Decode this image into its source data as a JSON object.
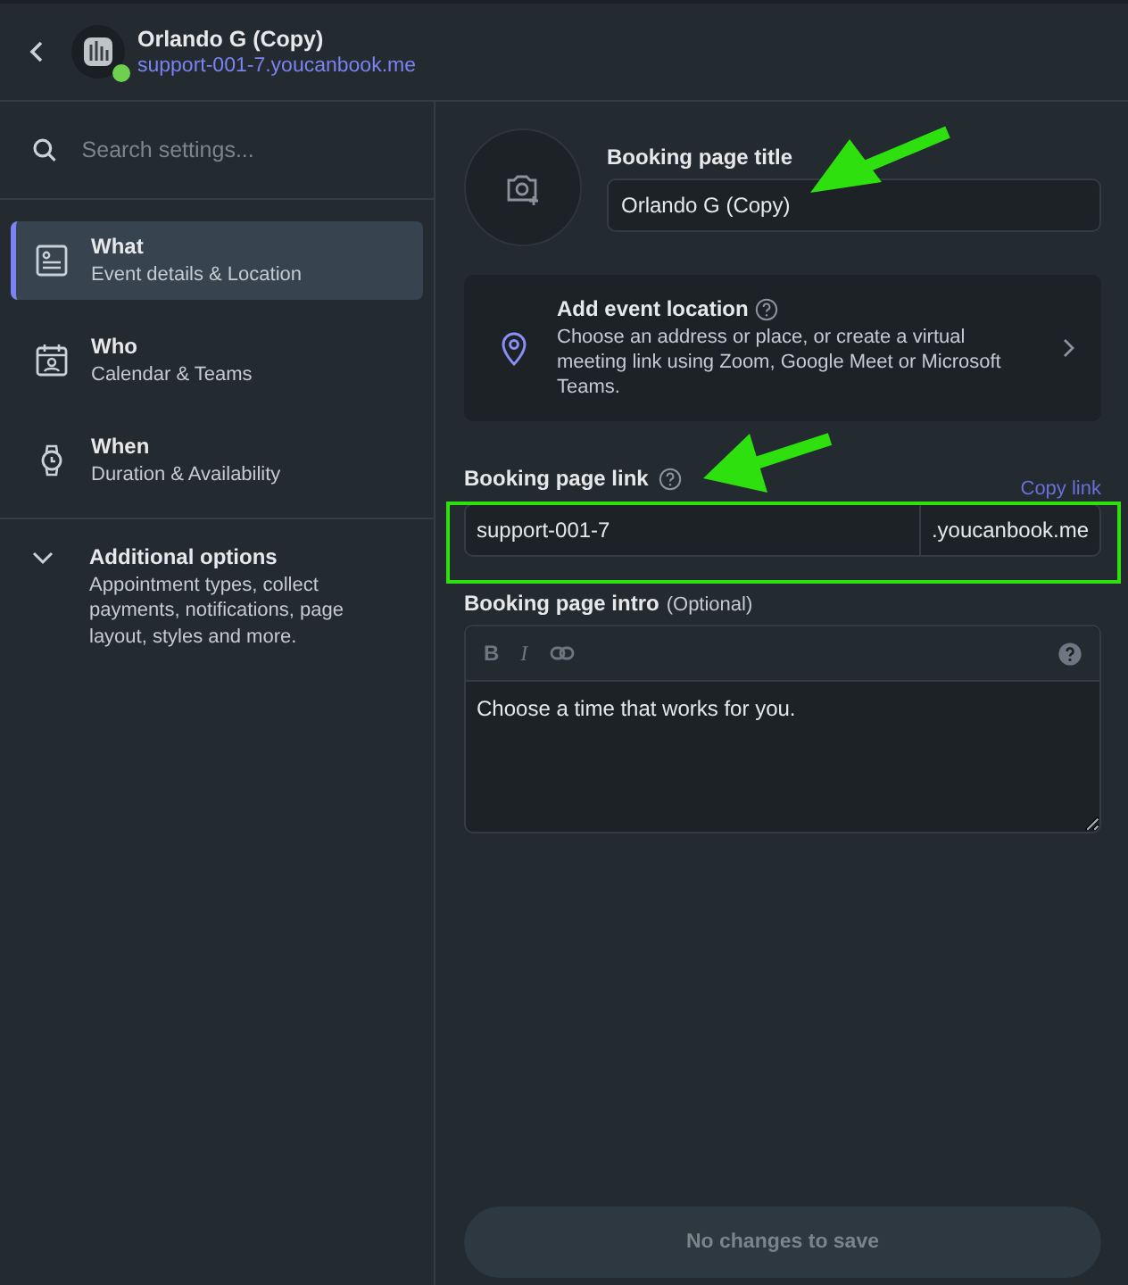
{
  "header": {
    "title": "Orlando G (Copy)",
    "link": "support-001-7.youcanbook.me",
    "online": true
  },
  "search": {
    "placeholder": "Search settings..."
  },
  "nav": [
    {
      "title": "What",
      "subtitle": "Event details & Location",
      "selected": true
    },
    {
      "title": "Who",
      "subtitle": "Calendar & Teams",
      "selected": false
    },
    {
      "title": "When",
      "subtitle": "Duration & Availability",
      "selected": false
    }
  ],
  "additional": {
    "title": "Additional options",
    "subtitle": "Appointment types, collect payments, notifications, page layout, styles and more.",
    "expanded": false
  },
  "title_field": {
    "label": "Booking page title",
    "value": "Orlando G (Copy)"
  },
  "location": {
    "title": "Add event location",
    "description": "Choose an address or place, or create a virtual meeting link using Zoom, Google Meet or Microsoft Teams."
  },
  "link_field": {
    "label": "Booking page link",
    "action": "Copy link",
    "value": "support-001-7",
    "suffix": ".youcanbook.me"
  },
  "intro_field": {
    "label": "Booking page intro",
    "hint": "(Optional)",
    "value": "Choose a time that works for you.",
    "toolbar": [
      "B",
      "I"
    ]
  },
  "save_button": {
    "label": "No changes to save",
    "disabled": true
  }
}
